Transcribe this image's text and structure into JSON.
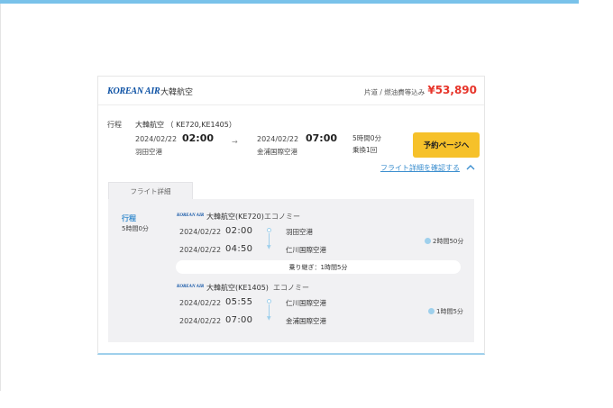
{
  "header": {
    "logo_text": "KOREAN AIR",
    "airline_name": "大韓航空",
    "fare_note": "片道 / 燃油費等込み",
    "price": "¥53,890"
  },
  "summary": {
    "trip_label": "行程",
    "airline_flights": "大韓航空 （ KE720,KE1405）",
    "departure": {
      "date": "2024/02/22",
      "time": "02:00",
      "airport": "羽田空港"
    },
    "arrow": "→",
    "arrival": {
      "date": "2024/02/22",
      "time": "07:00",
      "airport": "金浦国際空港"
    },
    "duration": "5時間0分",
    "transfers": "乗換1回",
    "book_button": "予約ページへ",
    "detail_link": "フライト詳細を確認する"
  },
  "detail": {
    "tab_label": "フライト詳細",
    "trip_label": "行程",
    "trip_duration": "5時間0分",
    "segments": [
      {
        "logo_text": "KOREAN AIR",
        "airline_flight": "大韓航空(KE720)",
        "cabin": "エコノミー",
        "dep_date": "2024/02/22",
        "dep_time": "02:00",
        "dep_airport": "羽田空港",
        "arr_date": "2024/02/22",
        "arr_time": "04:50",
        "arr_airport": "仁川国際空港",
        "duration": "2時間50分"
      },
      {
        "logo_text": "KOREAN AIR",
        "airline_flight": "大韓航空(KE1405)",
        "cabin": "エコノミー",
        "dep_date": "2024/02/22",
        "dep_time": "05:55",
        "dep_airport": "仁川国際空港",
        "arr_date": "2024/02/22",
        "arr_time": "07:00",
        "arr_airport": "金浦国際空港",
        "duration": "1時間5分"
      }
    ],
    "layover": "乗り継ぎ：1時間5分"
  },
  "colors": {
    "accent": "#79c2ea",
    "price": "#e7352b",
    "button": "#f6c12a",
    "link": "#3d8fcf",
    "brand": "#0a4fa3"
  },
  "icons": [
    "chevron-up-icon",
    "clock-icon",
    "arrow-right-icon"
  ]
}
